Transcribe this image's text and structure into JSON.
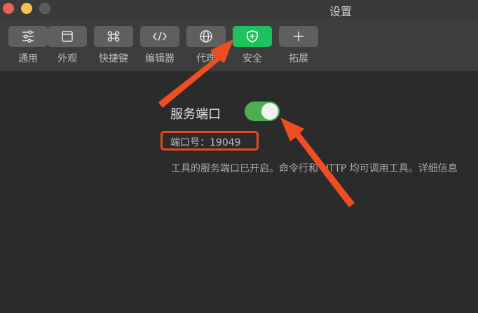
{
  "window": {
    "title": "设置"
  },
  "toolbar": {
    "tabs": [
      {
        "label": "通用",
        "icon": "sliders-icon"
      },
      {
        "label": "外观",
        "icon": "window-icon"
      },
      {
        "label": "快捷键",
        "icon": "command-key-icon"
      },
      {
        "label": "编辑器",
        "icon": "code-icon"
      },
      {
        "label": "代理",
        "icon": "globe-icon"
      },
      {
        "label": "安全",
        "icon": "shield-icon",
        "active": true
      },
      {
        "label": "拓展",
        "icon": "plus-icon"
      }
    ]
  },
  "security": {
    "service_port_label": "服务端口",
    "service_port_enabled": true,
    "port_text": "端口号：19049",
    "description": "工具的服务端口已开启。命令行和 HTTP 均可调用工具。详细信息"
  },
  "colors": {
    "accent_green": "#1ec25d",
    "toggle_green": "#4caf50",
    "annotation_red": "#e8491d"
  }
}
